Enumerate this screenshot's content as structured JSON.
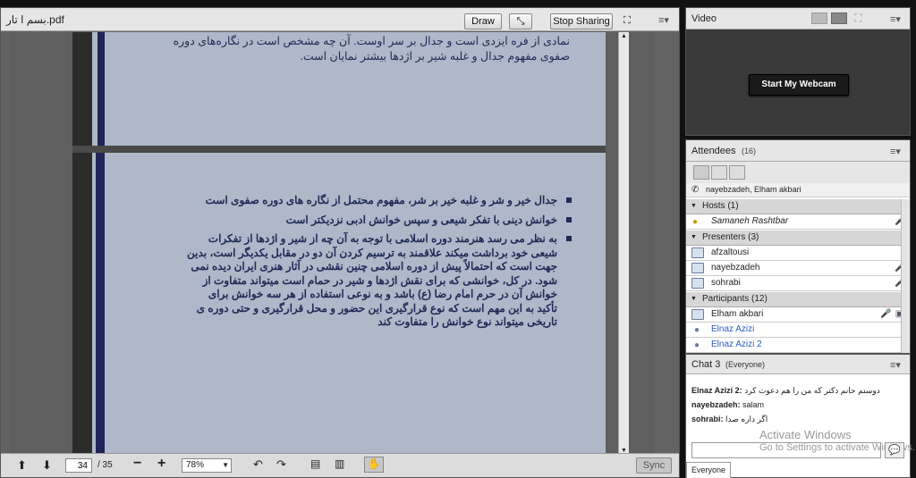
{
  "share": {
    "title": "بسم ا تار.pdf",
    "draw_label": "Draw",
    "stop_label": "Stop Sharing",
    "menu_icon": "menu-icon"
  },
  "slide_top": {
    "line1": "نمادی از فره ایزدی است و جدال بر سر اوست. آن چه مشخص است در نگاره‌های دوره",
    "line2": "صفوی مفهوم جدال و غلبه شیر بر اژدها بیشتر نمایان است."
  },
  "slide_bullets": [
    "جدال خیر و شر و غلبه خیر بر شر، مفهوم محتمل از نگاره های دوره صفوی است",
    "خوانش دینی با تفکر شیعی و سپس خوانش ادبی نزدیکتر است",
    "به نظر می رسد هنرمند دوره اسلامی با توجه به آن چه از شیر و اژدها از تفکرات شیعی خود برداشت میکند علاقمند به ترسیم کردن آن دو در مقابل یکدیگر است، بدین جهت است که احتمالاً پیش از دوره اسلامی چنین نقشی در آثار هنری ایران دیده نمی شود. در کل، خوانشی که برای نقش اژدها و شیر در حمام است میتواند متفاوت از خوانش آن در حرم امام رضا (ع) باشد و به نوعی استفاده از هر سه خوانش برای تأکید به این مهم است که نوع قرارگیری این حضور و محل قرارگیری و حتی دوره ی تاریخی میتواند نوع خوانش را متفاوت کند"
  ],
  "toolbar": {
    "page": "34",
    "total": "/ 35",
    "zoom": "78%",
    "sync": "Sync"
  },
  "video": {
    "title": "Video",
    "webcam_label": "Start My Webcam"
  },
  "attendees": {
    "title": "Attendees",
    "count": "(16)",
    "speaking": "nayebzadeh, Elham akbari",
    "hosts_label": "Hosts (1)",
    "presenters_label": "Presenters (3)",
    "participants_label": "Participants (12)",
    "hosts": [
      "Samaneh Rashtbar"
    ],
    "presenters": [
      "afzaltousi",
      "nayebzadeh",
      "sohrabi"
    ],
    "participants": [
      "Elham akbari",
      "Elnaz Azizi",
      "Elnaz Azizi 2"
    ]
  },
  "chat": {
    "title": "Chat 3",
    "scope": "(Everyone)",
    "messages": [
      {
        "name": "Elnaz Azizi 2:",
        "text": "دوستم حانم دکتر که من را هم دعوت کرد"
      },
      {
        "name": "nayebzadeh:",
        "text": "salam"
      },
      {
        "name": "sohrabi:",
        "text": "اگر داره صدا"
      }
    ],
    "tab": "Everyone"
  },
  "watermark": {
    "line1": "Activate Windows",
    "line2": "Go to Settings to activate Windows."
  },
  "colors": {
    "slide_bg": "#aeb8c8",
    "text": "#1e2a55",
    "stripe": "#1e2458"
  }
}
